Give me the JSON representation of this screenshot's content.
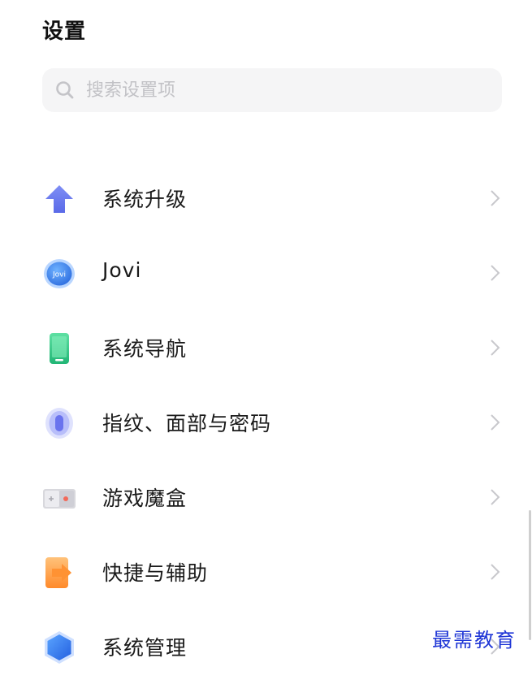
{
  "header": {
    "title": "设置"
  },
  "search": {
    "icon": "search-icon",
    "placeholder": "搜索设置项",
    "value": ""
  },
  "settings_items": [
    {
      "label": "系统升级",
      "icon": "system-upgrade-arrow-icon",
      "color": "#6b7cf0"
    },
    {
      "label": "Jovi",
      "icon": "jovi-icon",
      "color": "#3a7ee8"
    },
    {
      "label": "系统导航",
      "icon": "phone-navigation-icon",
      "color": "#3ccf8e"
    },
    {
      "label": "指纹、面部与密码",
      "icon": "fingerprint-icon",
      "color": "#6e79f0"
    },
    {
      "label": "游戏魔盒",
      "icon": "game-box-icon",
      "color": "#e8e8ec"
    },
    {
      "label": "快捷与辅助",
      "icon": "shortcut-icon",
      "color": "#ff9a3c"
    },
    {
      "label": "系统管理",
      "icon": "system-management-hexagon-icon",
      "color": "#2f74ea"
    }
  ],
  "watermark": "最需教育"
}
